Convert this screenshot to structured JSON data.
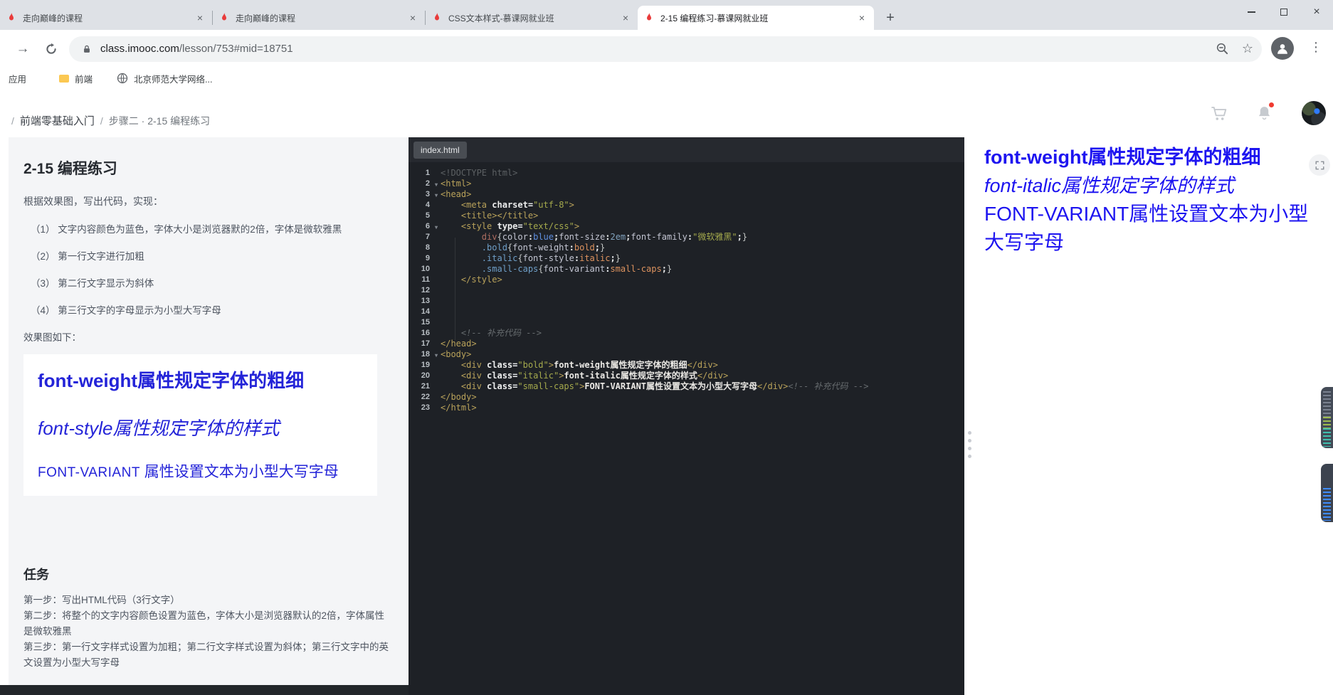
{
  "colors": {
    "imooc_red": "#e93b3b",
    "chrome_strip": "#dee1e6",
    "editor_bg": "#1e2126",
    "panel_bg": "#f4f5f7",
    "preview_blue": "#1d14f0",
    "effect_blue": "#2424d8",
    "notification_red": "#f03b30"
  },
  "icons": {
    "forward_arrow": "→",
    "overflow_menu": "⋮",
    "bookmark_star": "☆",
    "new_tab_plus": "+",
    "tab_close": "×",
    "window_close": "×"
  },
  "browser": {
    "tabs": [
      {
        "title": "走向巅峰的课程"
      },
      {
        "title": "走向巅峰的课程"
      },
      {
        "title": "CSS文本样式-慕课网就业班"
      },
      {
        "title": "2-15 编程练习-慕课网就业班"
      }
    ],
    "url": {
      "domain": "class.imooc.com",
      "path": "/lesson/753#mid=18751"
    },
    "bookmarks": {
      "apps": "应用",
      "folder": "前端",
      "site": "北京师范大学网络..."
    }
  },
  "site": {
    "breadcrumb": {
      "sep1": "/",
      "course": "前端零基础入门",
      "sep2": "/",
      "lesson": "步骤二 · 2-15 编程练习"
    }
  },
  "exercise": {
    "title": "2-15 编程练习",
    "intro": "根据效果图，写出代码，实现：",
    "requirements": [
      "（1）  文字内容颜色为蓝色，字体大小是浏览器默的2倍，字体是微软雅黑",
      "（2）  第一行文字进行加粗",
      "（3）  第二行文字显示为斜体",
      "（4）  第三行文字的字母显示为小型大写字母"
    ],
    "effect_label": "效果图如下：",
    "effect": {
      "line_bold": "font-weight属性规定字体的粗细",
      "line_italic": "font-style属性规定字体的样式",
      "line_caps_en": "FONT-VARIANT",
      "line_caps_zh": " 属性设置文本为小型大写字母"
    },
    "task_title": "任务",
    "tasks": [
      "第一步：写出HTML代码（3行文字）",
      "第二步：将整个的文字内容颜色设置为蓝色，字体大小是浏览器默认的2倍，字体属性是微软雅黑",
      "第三步：第一行文字样式设置为加粗；第二行文字样式设置为斜体；第三行文字中的英文设置为小型大写字母"
    ]
  },
  "editor": {
    "tab": "index.html",
    "lines": [
      {
        "n": 1,
        "tk": [
          [
            "doc",
            "<!DOCTYPE html>"
          ]
        ]
      },
      {
        "n": 2,
        "f": 1,
        "tk": [
          [
            "tag",
            "<html>"
          ]
        ]
      },
      {
        "n": 3,
        "f": 1,
        "tk": [
          [
            "tag",
            "<head>"
          ]
        ]
      },
      {
        "n": 4,
        "tk": [
          [
            "pl",
            "    "
          ],
          [
            "tag",
            "<meta "
          ],
          [
            "attr",
            "charset"
          ],
          [
            "pn",
            "="
          ],
          [
            "str",
            "\"utf-8\""
          ],
          [
            "tag",
            ">"
          ]
        ]
      },
      {
        "n": 5,
        "tk": [
          [
            "pl",
            "    "
          ],
          [
            "tag",
            "<title></title>"
          ]
        ]
      },
      {
        "n": 6,
        "f": 1,
        "tk": [
          [
            "pl",
            "    "
          ],
          [
            "tag",
            "<style "
          ],
          [
            "attr",
            "type"
          ],
          [
            "pn",
            "="
          ],
          [
            "str",
            "\"text/css\""
          ],
          [
            "tag",
            ">"
          ]
        ]
      },
      {
        "n": 7,
        "tk": [
          [
            "pl",
            "        "
          ],
          [
            "sel",
            "div"
          ],
          [
            "pl",
            "{"
          ],
          [
            "prop",
            "color"
          ],
          [
            "pn",
            ":"
          ],
          [
            "vb",
            "blue"
          ],
          [
            "pn",
            ";"
          ],
          [
            "prop",
            "font-size"
          ],
          [
            "pn",
            ":"
          ],
          [
            "num",
            "2em"
          ],
          [
            "pn",
            ";"
          ],
          [
            "prop",
            "font-family"
          ],
          [
            "pn",
            ":"
          ],
          [
            "str",
            "\"微软雅黑\""
          ],
          [
            "pn",
            ";"
          ],
          [
            "pl",
            "}"
          ]
        ]
      },
      {
        "n": 8,
        "tk": [
          [
            "pl",
            "        "
          ],
          [
            "cls",
            ".bold"
          ],
          [
            "pl",
            "{"
          ],
          [
            "prop",
            "font-weight"
          ],
          [
            "pn",
            ":"
          ],
          [
            "val",
            "bold"
          ],
          [
            "pn",
            ";"
          ],
          [
            "pl",
            "}"
          ]
        ]
      },
      {
        "n": 9,
        "tk": [
          [
            "pl",
            "        "
          ],
          [
            "cls",
            ".italic"
          ],
          [
            "pl",
            "{"
          ],
          [
            "prop",
            "font-style"
          ],
          [
            "pn",
            ":"
          ],
          [
            "val",
            "italic"
          ],
          [
            "pn",
            ";"
          ],
          [
            "pl",
            "}"
          ]
        ]
      },
      {
        "n": 10,
        "tk": [
          [
            "pl",
            "        "
          ],
          [
            "cls",
            ".small-caps"
          ],
          [
            "pl",
            "{"
          ],
          [
            "prop",
            "font-variant"
          ],
          [
            "pn",
            ":"
          ],
          [
            "val",
            "small-caps"
          ],
          [
            "pn",
            ";"
          ],
          [
            "pl",
            "}"
          ]
        ]
      },
      {
        "n": 11,
        "tk": [
          [
            "pl",
            "    "
          ],
          [
            "tag",
            "</style>"
          ]
        ]
      },
      {
        "n": 12,
        "tk": []
      },
      {
        "n": 13,
        "tk": []
      },
      {
        "n": 14,
        "tk": []
      },
      {
        "n": 15,
        "tk": []
      },
      {
        "n": 16,
        "tk": [
          [
            "pl",
            "    "
          ],
          [
            "com",
            "<!-- 补充代码 -->"
          ]
        ]
      },
      {
        "n": 17,
        "tk": [
          [
            "tag",
            "</head>"
          ]
        ]
      },
      {
        "n": 18,
        "f": 1,
        "tk": [
          [
            "tag",
            "<body>"
          ]
        ]
      },
      {
        "n": 19,
        "tk": [
          [
            "pl",
            "    "
          ],
          [
            "tag",
            "<div "
          ],
          [
            "attr",
            "class"
          ],
          [
            "pn",
            "="
          ],
          [
            "str",
            "\"bold\""
          ],
          [
            "tag",
            ">"
          ],
          [
            "txt",
            "font-weight属性规定字体的粗细"
          ],
          [
            "tag",
            "</div>"
          ]
        ]
      },
      {
        "n": 20,
        "tk": [
          [
            "pl",
            "    "
          ],
          [
            "tag",
            "<div "
          ],
          [
            "attr",
            "class"
          ],
          [
            "pn",
            "="
          ],
          [
            "str",
            "\"italic\""
          ],
          [
            "tag",
            ">"
          ],
          [
            "txt",
            "font-italic属性规定字体的样式"
          ],
          [
            "tag",
            "</div>"
          ]
        ]
      },
      {
        "n": 21,
        "tk": [
          [
            "pl",
            "    "
          ],
          [
            "tag",
            "<div "
          ],
          [
            "attr",
            "class"
          ],
          [
            "pn",
            "="
          ],
          [
            "str",
            "\"small-caps\""
          ],
          [
            "tag",
            ">"
          ],
          [
            "txt",
            "FONT-VARIANT属性设置文本为小型大写字母"
          ],
          [
            "tag",
            "</div>"
          ],
          [
            "com",
            "<!-- 补充代码 -->"
          ]
        ]
      },
      {
        "n": 22,
        "tk": [
          [
            "tag",
            "</body>"
          ]
        ]
      },
      {
        "n": 23,
        "tk": [
          [
            "tag",
            "</html>"
          ]
        ]
      }
    ]
  },
  "preview": {
    "line_bold": "font-weight属性规定字体的粗细",
    "line_italic": "font-italic属性规定字体的样式",
    "line_caps": "FONT-VARIANT属性设置文本为小型大写字母"
  }
}
